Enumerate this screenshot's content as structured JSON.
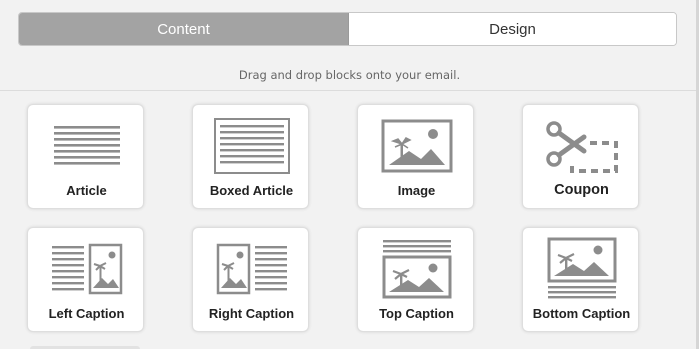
{
  "tabs": [
    {
      "label": "Content",
      "active": true
    },
    {
      "label": "Design",
      "active": false
    }
  ],
  "hint": "Drag and drop blocks onto your email.",
  "blocks": [
    {
      "label": "Article",
      "icon": "article-icon"
    },
    {
      "label": "Boxed Article",
      "icon": "boxed-article-icon"
    },
    {
      "label": "Image",
      "icon": "image-icon"
    },
    {
      "label": "Coupon",
      "icon": "scissors-coupon-icon"
    },
    {
      "label": "Left Caption",
      "icon": "left-caption-icon"
    },
    {
      "label": "Right Caption",
      "icon": "right-caption-icon"
    },
    {
      "label": "Top Caption",
      "icon": "top-caption-icon"
    },
    {
      "label": "Bottom Caption",
      "icon": "bottom-caption-icon"
    }
  ],
  "colors": {
    "active_tab_bg": "#a3a3a3",
    "icon_gray": "#8c8c8c",
    "panel_bg": "#f2f2f2"
  }
}
